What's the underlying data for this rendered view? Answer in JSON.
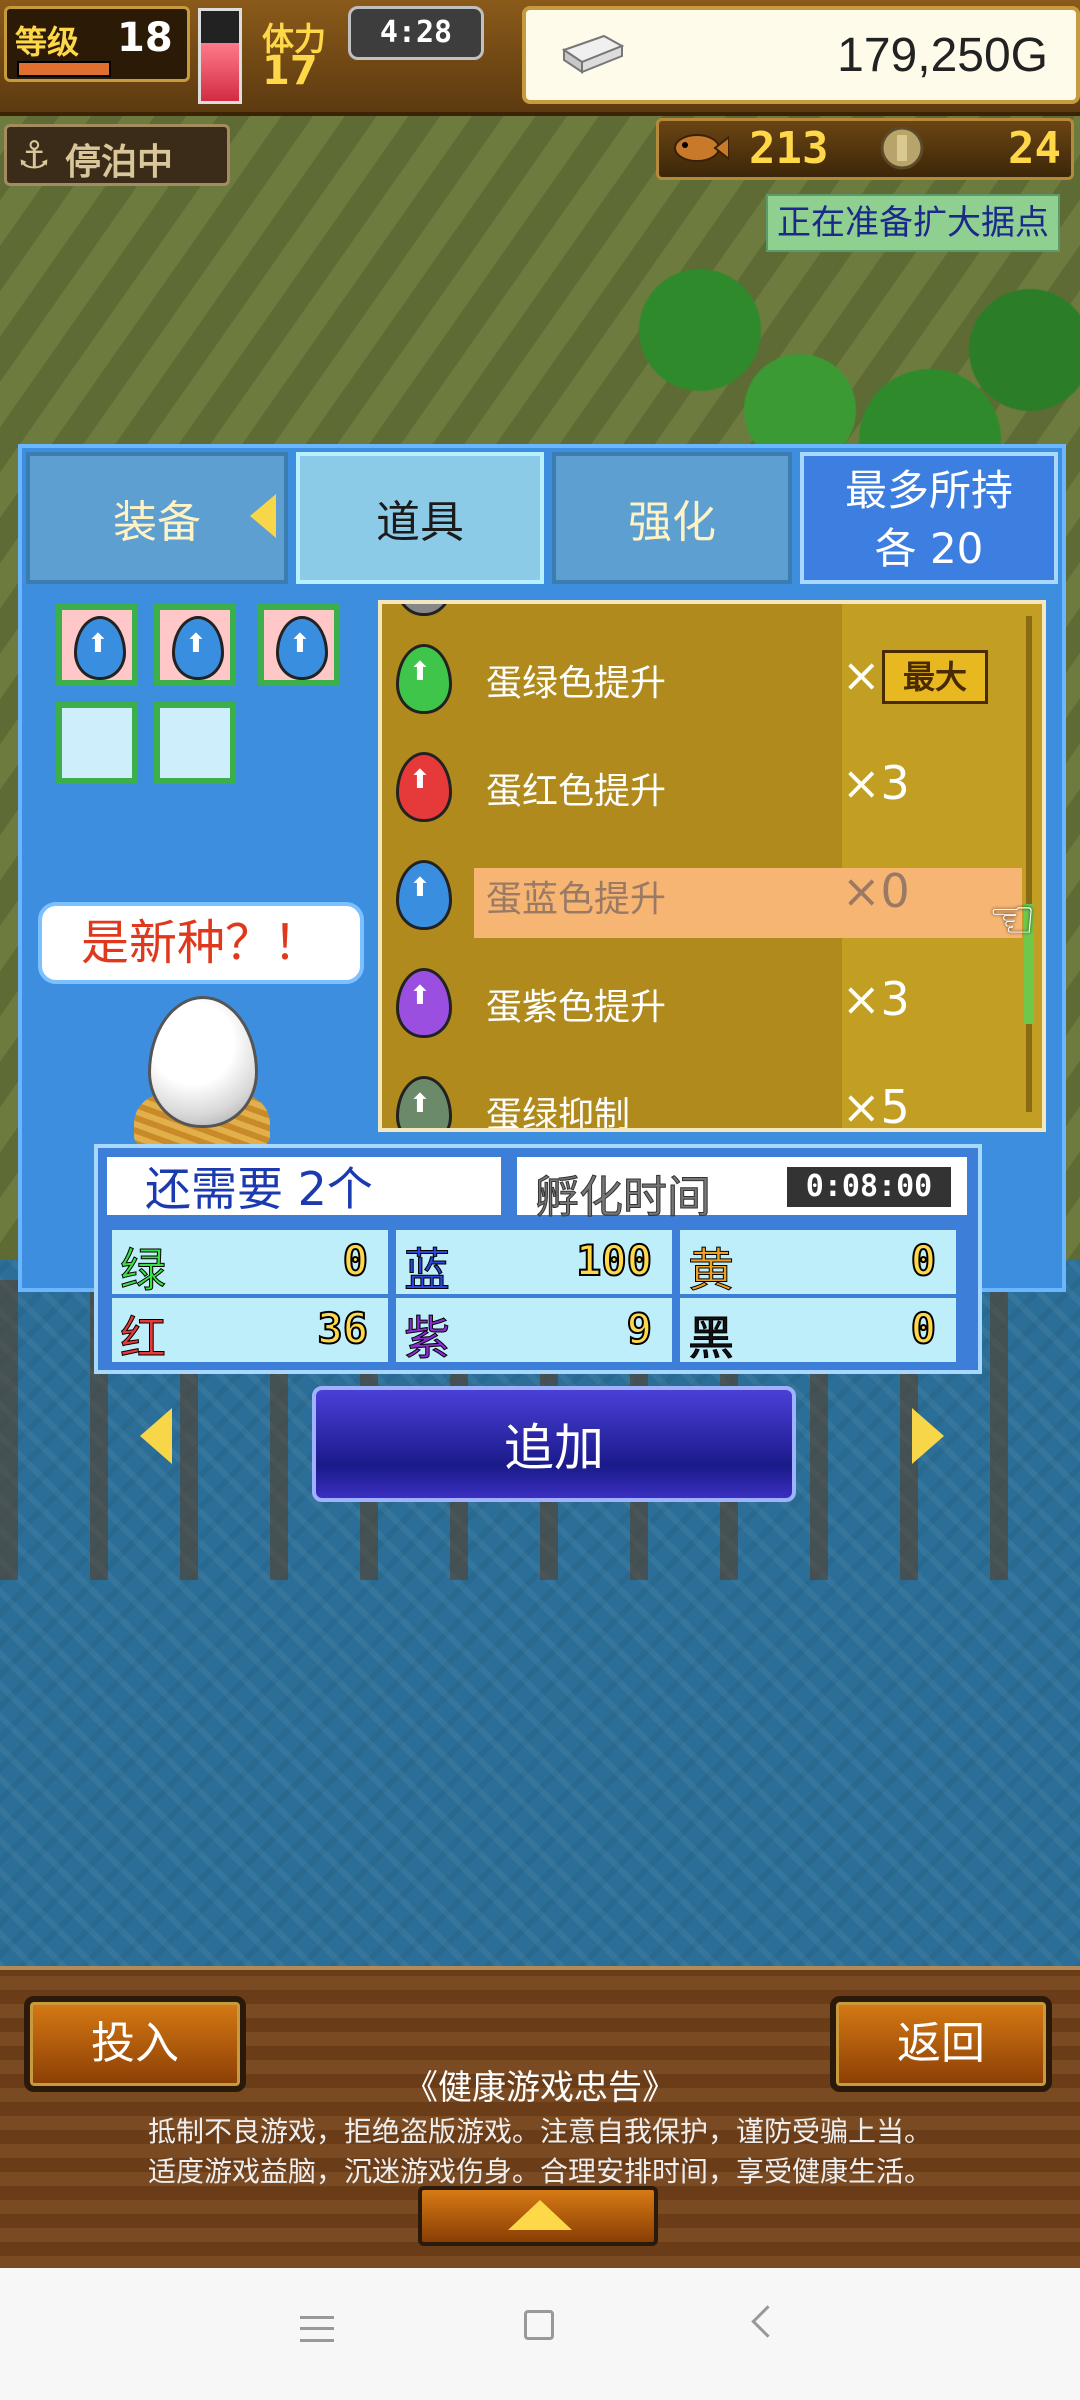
{
  "hud": {
    "level_label": "等级",
    "level_value": "18",
    "stamina_label": "体力",
    "stamina_value": "17",
    "clock": "4:28",
    "gold": "179,250G",
    "status": "停泊中",
    "fish_count": "213",
    "coin_count": "24",
    "notice": "正在准备扩大据点"
  },
  "tabs": [
    {
      "label": "装备"
    },
    {
      "label": "道具"
    },
    {
      "label": "强化"
    }
  ],
  "max_hold": {
    "line1": "最多所持",
    "line2": "各 20"
  },
  "slots": [
    {
      "egg": "blue"
    },
    {
      "egg": "blue"
    },
    {
      "egg": "blue"
    },
    {
      "egg": null
    },
    {
      "egg": null
    }
  ],
  "speech": "是新种？！",
  "items": [
    {
      "name": "蛋绿色提升",
      "qty_prefix": "×",
      "qty_badge": "最大",
      "color": "#3ec54a"
    },
    {
      "name": "蛋红色提升",
      "qty": "×3",
      "color": "#e5393a"
    },
    {
      "name": "蛋蓝色提升",
      "qty": "×0",
      "color": "#3a8ee0",
      "selected": true
    },
    {
      "name": "蛋紫色提升",
      "qty": "×3",
      "color": "#9b4fe0"
    },
    {
      "name": "蛋绿抑制",
      "qty": "×5",
      "color": "#6a8a6a"
    }
  ],
  "incubator": {
    "need_text": "还需要 2个",
    "hatch_label": "孵化时间",
    "hatch_time": "0:08:00",
    "stats": [
      {
        "key": "绿",
        "value": "0",
        "color": "#3ee04a"
      },
      {
        "key": "蓝",
        "value": "100",
        "color": "#2b46d8"
      },
      {
        "key": "黄",
        "value": "0",
        "color": "#f0a020"
      },
      {
        "key": "红",
        "value": "36",
        "color": "#e5393a"
      },
      {
        "key": "紫",
        "value": "9",
        "color": "#8a2ed0"
      },
      {
        "key": "黑",
        "value": "0",
        "color": "#111111"
      }
    ]
  },
  "add_button": "追加",
  "footer": {
    "put_in": "投入",
    "back": "返回",
    "health_title": "《健康游戏忠告》",
    "health_line1": "抵制不良游戏，拒绝盗版游戏。注意自我保护，谨防受骗上当。",
    "health_line2": "适度游戏益脑，沉迷游戏伤身。合理安排时间，享受健康生活。"
  },
  "hp_fill_ratio": 0.65,
  "level_exp_ratio": 0.3
}
